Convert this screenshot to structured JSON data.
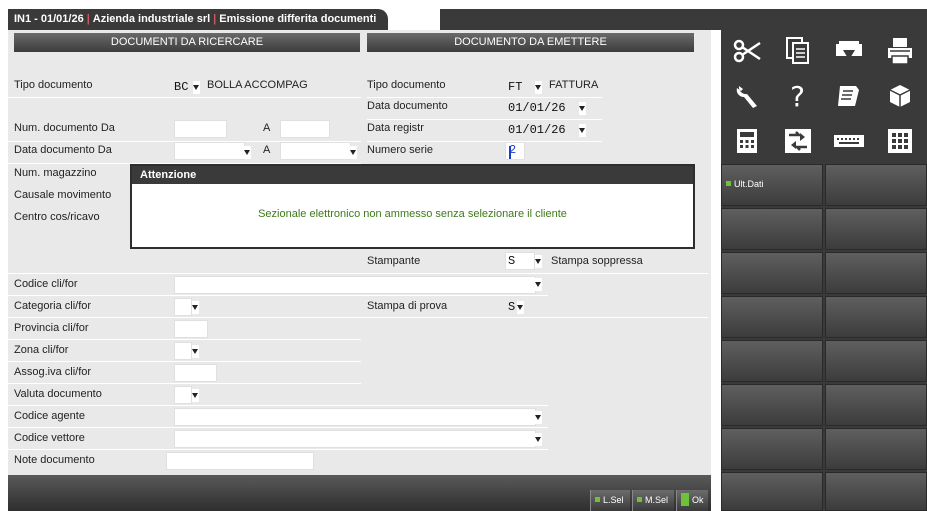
{
  "window": {
    "title_code": "IN1 - 01/01/26",
    "company": "Azienda industriale srl",
    "function": "Emissione differita documenti"
  },
  "left_section": {
    "header": "DOCUMENTI DA RICERCARE",
    "tipo_documento": {
      "label": "Tipo documento",
      "code": "BC",
      "description": "BOLLA ACCOMPAG"
    },
    "num_documento": {
      "label": "Num. documento Da",
      "to_label": "A",
      "from": "",
      "to": ""
    },
    "data_documento": {
      "label": "Data documento Da",
      "to_label": "A",
      "from": "",
      "to": ""
    },
    "num_magazzino": {
      "label": "Num. magazzino"
    },
    "causale": {
      "label": "Causale movimento"
    },
    "centro": {
      "label": "Centro cos/ricavo"
    },
    "codice_clifor": {
      "label": "Codice cli/for",
      "value": ""
    },
    "categoria_clifor": {
      "label": "Categoria cli/for",
      "value": ""
    },
    "provincia_clifor": {
      "label": "Provincia cli/for",
      "value": ""
    },
    "zona_clifor": {
      "label": "Zona cli/for",
      "value": ""
    },
    "assog_iva": {
      "label": "Assog.iva cli/for",
      "value": ""
    },
    "valuta": {
      "label": "Valuta documento",
      "value": ""
    },
    "codice_agente": {
      "label": "Codice agente",
      "value": ""
    },
    "codice_vettore": {
      "label": "Codice vettore",
      "value": ""
    },
    "note": {
      "label": "Note documento",
      "value": ""
    }
  },
  "right_section": {
    "header": "DOCUMENTO DA EMETTERE",
    "tipo_documento": {
      "label": "Tipo documento",
      "code": "FT",
      "description": "FATTURA"
    },
    "data_documento": {
      "label": "Data documento",
      "value": "01/01/26"
    },
    "data_registr": {
      "label": "Data registr",
      "value": "01/01/26"
    },
    "numero_serie": {
      "label": "Numero serie",
      "value": "2"
    },
    "stampante": {
      "label": "Stampante",
      "value": "S",
      "description": "Stampa soppressa"
    },
    "stampa_prova": {
      "label": "Stampa di prova",
      "value": "S"
    }
  },
  "dialog": {
    "title": "Attenzione",
    "message": "Sezionale elettronico non ammesso senza selezionare il cliente"
  },
  "bottom_buttons": {
    "lsel": "L.Sel",
    "msel": "M.Sel",
    "ok": "Ok"
  },
  "sidebar": {
    "icons": [
      "scissors-icon",
      "copy-icon",
      "printer-tray-icon",
      "printer-icon",
      "wrench-icon",
      "help-icon",
      "notepad-icon",
      "package-icon",
      "calculator-icon",
      "swap-arrows-icon",
      "keyboard-icon",
      "grid-icon"
    ],
    "ult_dati": "Ult.Dati"
  },
  "colors": {
    "accent_green": "#6ec23a",
    "dialog_text": "#3e7a1a",
    "dark_chrome": "#3a3a3a"
  }
}
